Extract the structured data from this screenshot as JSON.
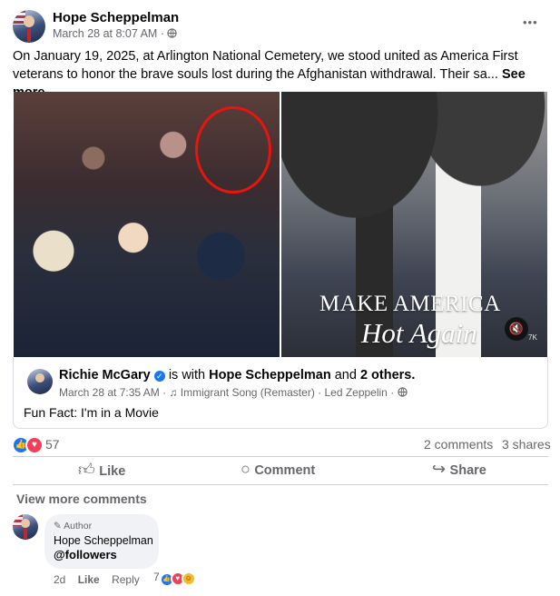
{
  "post": {
    "author": "Hope Scheppelman",
    "time": "March 28 at 8:07 AM",
    "text": "On January 19, 2025, at Arlington National Cemetery, we stood united as America First veterans to honor the brave souls lost during the Afghanistan withdrawal. Their sa...",
    "see_more": "See more",
    "menu": "•••"
  },
  "media": {
    "overlay_line1": "MAKE AMERICA",
    "overlay_line2": "Hot Again",
    "watermark": "7K"
  },
  "shared": {
    "author": "Richie McGary",
    "is_with": "is with",
    "with_name": "Hope Scheppelman",
    "and": "and",
    "others": "2 others.",
    "time": "March 28 at 7:35 AM",
    "song": "Immigrant Song (Remaster) · Led Zeppelin",
    "text": "Fun Fact: I'm in a Movie"
  },
  "stats": {
    "reactions_count": "57",
    "comments": "2 comments",
    "shares": "3 shares"
  },
  "actions": {
    "like": "Like",
    "comment": "Comment",
    "share": "Share"
  },
  "comments_section": {
    "view_more": "View more comments",
    "comment": {
      "badge": "Author",
      "author": "Hope Scheppelman",
      "text": "@followers",
      "age": "2d",
      "like": "Like",
      "reply": "Reply",
      "reaction_count": "7"
    }
  },
  "colors": {
    "facebook_blue": "#1877f2",
    "secondary_text": "#65676b",
    "circle_red": "#e8140d"
  }
}
